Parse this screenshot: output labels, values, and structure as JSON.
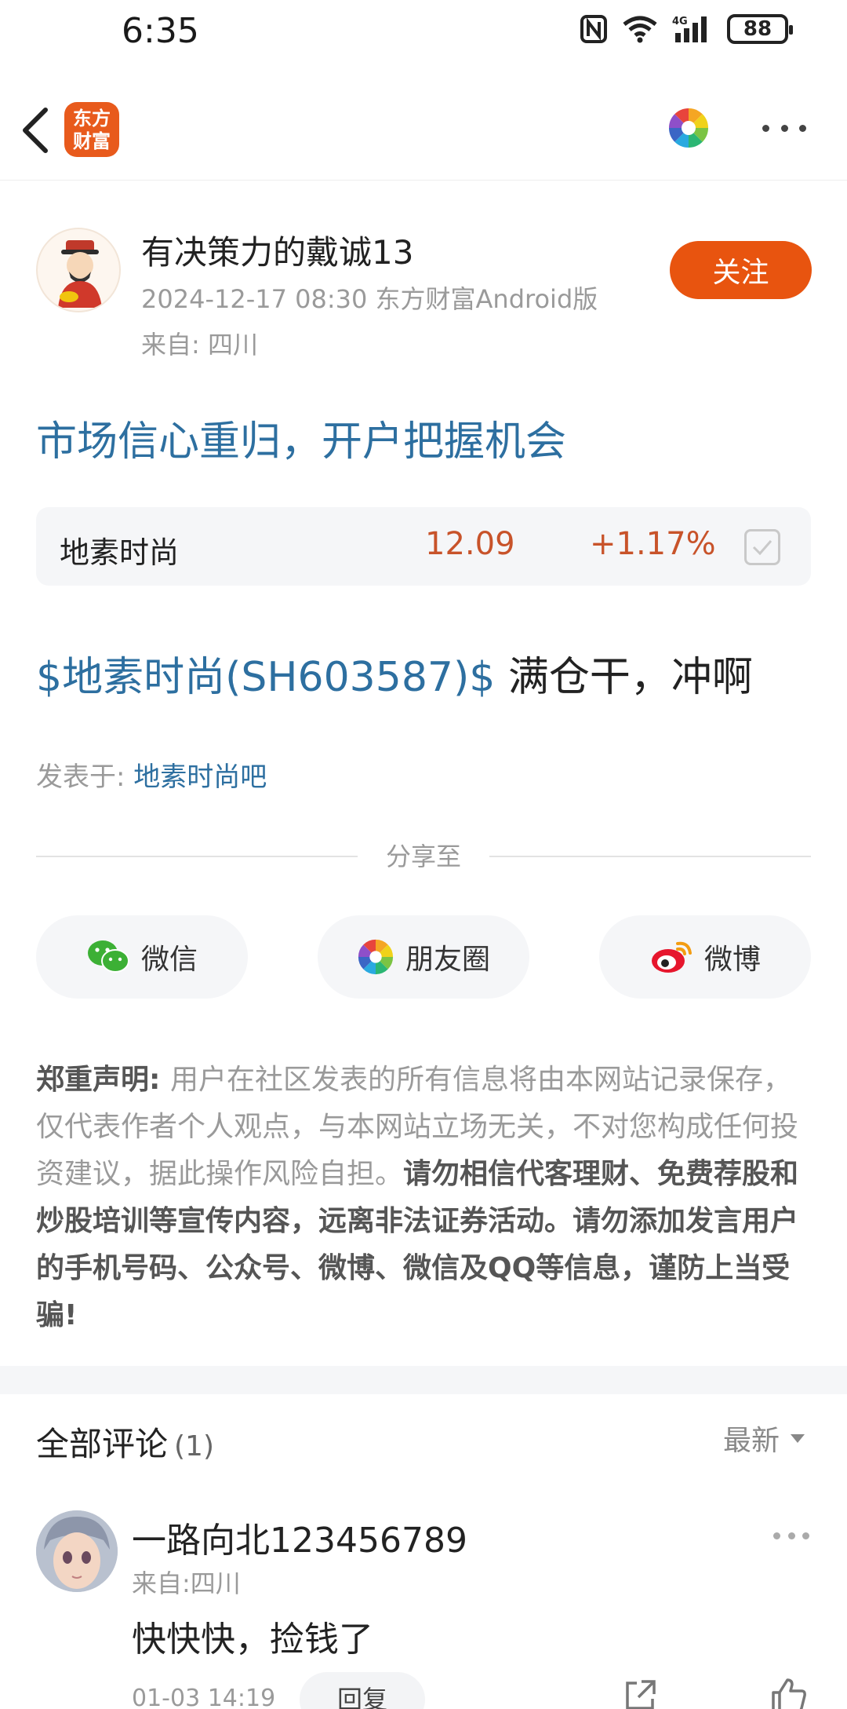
{
  "status_bar": {
    "time": "6:35",
    "battery": "88",
    "network": "4G"
  },
  "nav": {
    "logo_text_1": "东方",
    "logo_text_2": "财富"
  },
  "author": {
    "name": "有决策力的戴诚13",
    "meta": "2024-12-17 08:30 东方财富Android版",
    "location": "来自: 四川",
    "follow_label": "关注"
  },
  "post": {
    "title": "市场信心重归，开户把握机会",
    "stock_card": {
      "name": "地素时尚",
      "price": "12.09",
      "change": "+1.17%"
    },
    "body_stock": "$地素时尚(SH603587)$",
    "body_text": " 满仓干，冲啊",
    "posted_in_label": "发表于: ",
    "posted_in_link": "地素时尚吧"
  },
  "share": {
    "title": "分享至",
    "buttons": [
      "微信",
      "朋友圈",
      "微博"
    ]
  },
  "disclaimer": {
    "label": "郑重声明: ",
    "text_normal": "用户在社区发表的所有信息将由本网站记录保存，仅代表作者个人观点，与本网站立场无关，不对您构成任何投资建议，据此操作风险自担。",
    "text_strong": "请勿相信代客理财、免费荐股和炒股培训等宣传内容，远离非法证券活动。请勿添加发言用户的手机号码、公众号、微博、微信及QQ等信息，谨防上当受骗!"
  },
  "comments": {
    "title": "全部评论",
    "count": "(1)",
    "sort_label": "最新",
    "items": [
      {
        "name": "一路向北123456789",
        "location": "来自:四川",
        "text": "快快快，捡钱了",
        "time": "01-03 14:19",
        "reply_label": "回复"
      }
    ]
  },
  "colors": {
    "accent": "#e8540f",
    "link": "#2d6fa0",
    "price_up": "#c8532a"
  }
}
